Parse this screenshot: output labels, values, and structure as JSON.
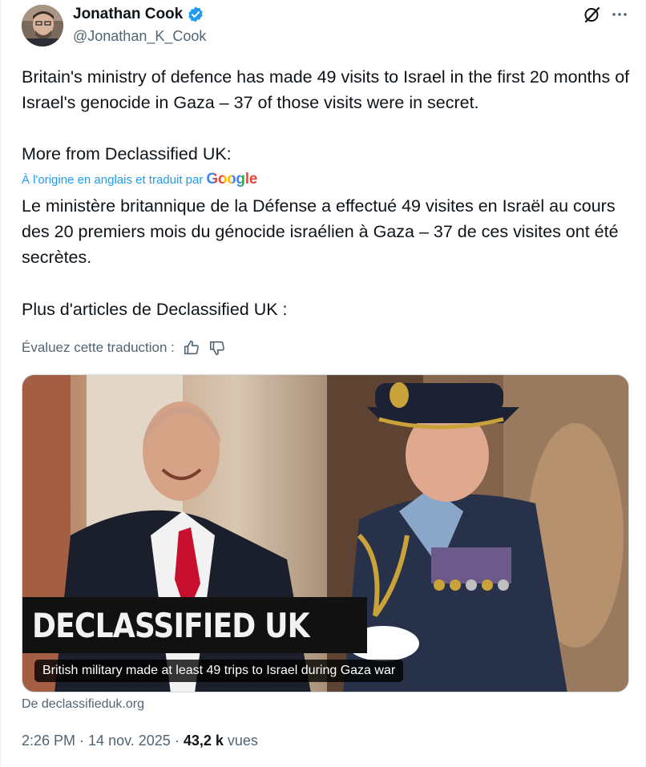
{
  "author": {
    "name": "Jonathan Cook",
    "handle": "@Jonathan_K_Cook",
    "verified_color": "#1d9bf0"
  },
  "header_icons": {
    "grok": "grok-icon",
    "more": "more-icon"
  },
  "post": {
    "original_text": "Britain's ministry of defence has made 49 visits to Israel in the first 20 months of Israel's genocide in Gaza – 37 of those visits were in secret.",
    "original_more": "More from Declassified UK:",
    "translated_by": "À l'origine en anglais et traduit par",
    "translator": "Google",
    "translated_text": "Le ministère britannique de la Défense a effectué 49 visites en Israël au cours des 20 premiers mois du génocide israélien à Gaza – 37 de ces visites ont été secrètes.",
    "translated_more": "Plus d'articles de Declassified UK :",
    "rate_label": "Évaluez cette traduction :"
  },
  "card": {
    "brand": "DECLASSIFIED UK",
    "caption": "British military made at least 49 trips to Israel during Gaza war",
    "source": "De declassifieduk.org"
  },
  "meta": {
    "time": "2:26 PM",
    "date": "14 nov. 2025",
    "views_count": "43,2 k",
    "views_label": "vues"
  }
}
